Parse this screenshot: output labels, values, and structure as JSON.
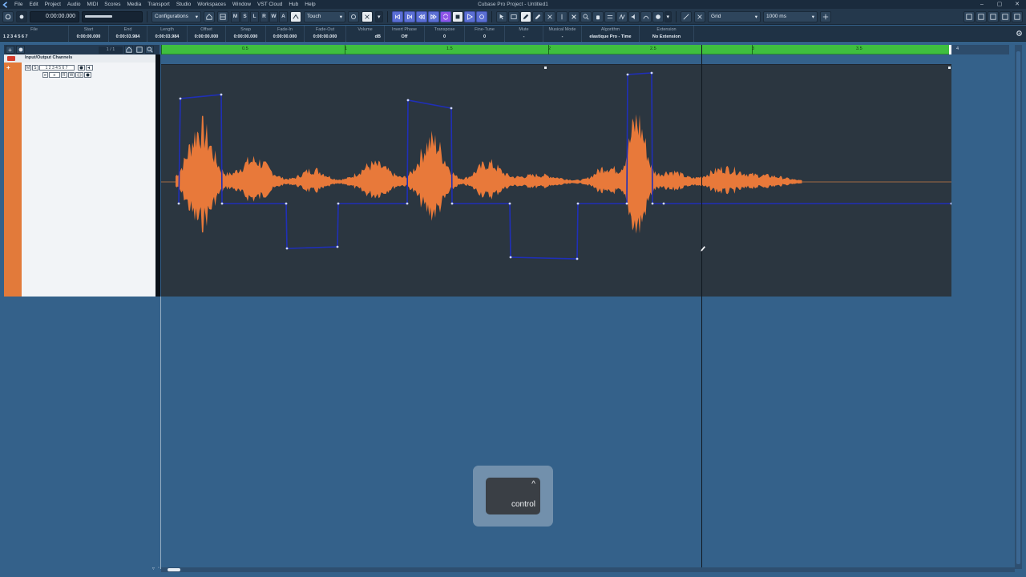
{
  "window": {
    "title": "Cubase Pro Project - Untitled1",
    "controls": [
      "–",
      "▢",
      "✕"
    ]
  },
  "menu": [
    "File",
    "Edit",
    "Project",
    "Audio",
    "MIDI",
    "Scores",
    "Media",
    "Transport",
    "Studio",
    "Workspaces",
    "Window",
    "VST Cloud",
    "Hub",
    "Help"
  ],
  "toolbar": {
    "time_display": "0:00:00.000",
    "configurations": "Configurations",
    "track_letters": [
      "M",
      "S",
      "L",
      "R",
      "W",
      "A"
    ],
    "automation_mode": "Touch",
    "snap_type": "Grid",
    "grid_value": "1000 ms"
  },
  "infoline": [
    {
      "label": "File",
      "value": "1 2 3 4 5 6 7"
    },
    {
      "label": "Start",
      "value": "0:00:00.000"
    },
    {
      "label": "End",
      "value": "0:00:03.984"
    },
    {
      "label": "Length",
      "value": "0:00:03.984"
    },
    {
      "label": "Offset",
      "value": "0:00:00.000"
    },
    {
      "label": "Snap",
      "value": "0:00:00.000"
    },
    {
      "label": "Fade-In",
      "value": "0:00:00.000"
    },
    {
      "label": "Fade-Out",
      "value": "0:00:00.000"
    },
    {
      "label": "Volume",
      "value": "dB"
    },
    {
      "label": "Invert Phase",
      "value": "Off"
    },
    {
      "label": "Transpose",
      "value": "0"
    },
    {
      "label": "Fine-Tune",
      "value": "0"
    },
    {
      "label": "Mute",
      "value": "-"
    },
    {
      "label": "Musical Mode",
      "value": "-"
    },
    {
      "label": "Algorithm",
      "value": "elastique Pro - Time"
    },
    {
      "label": "Extension",
      "value": "No Extension"
    }
  ],
  "tracklist": {
    "counter": "1 / 1",
    "folder_name": "Input/Output Channels",
    "track_name": "1 2 3 4 5 6 7",
    "buttons_row1": [
      "M",
      "S"
    ],
    "buttons_row2": [
      "e",
      "≡",
      "R",
      "W"
    ]
  },
  "ruler": {
    "labels": [
      "0.5",
      "1",
      "1.5",
      "2",
      "2.5",
      "3",
      "3.5"
    ],
    "after_label": "4"
  },
  "key_overlay": {
    "symbol": "^",
    "label": "control"
  },
  "colors": {
    "waveform": "#e8793a",
    "envelope": "#1f2fb8",
    "ruler": "#3fbf3f",
    "track_color": "#e27a3a",
    "background": "#34618a"
  }
}
